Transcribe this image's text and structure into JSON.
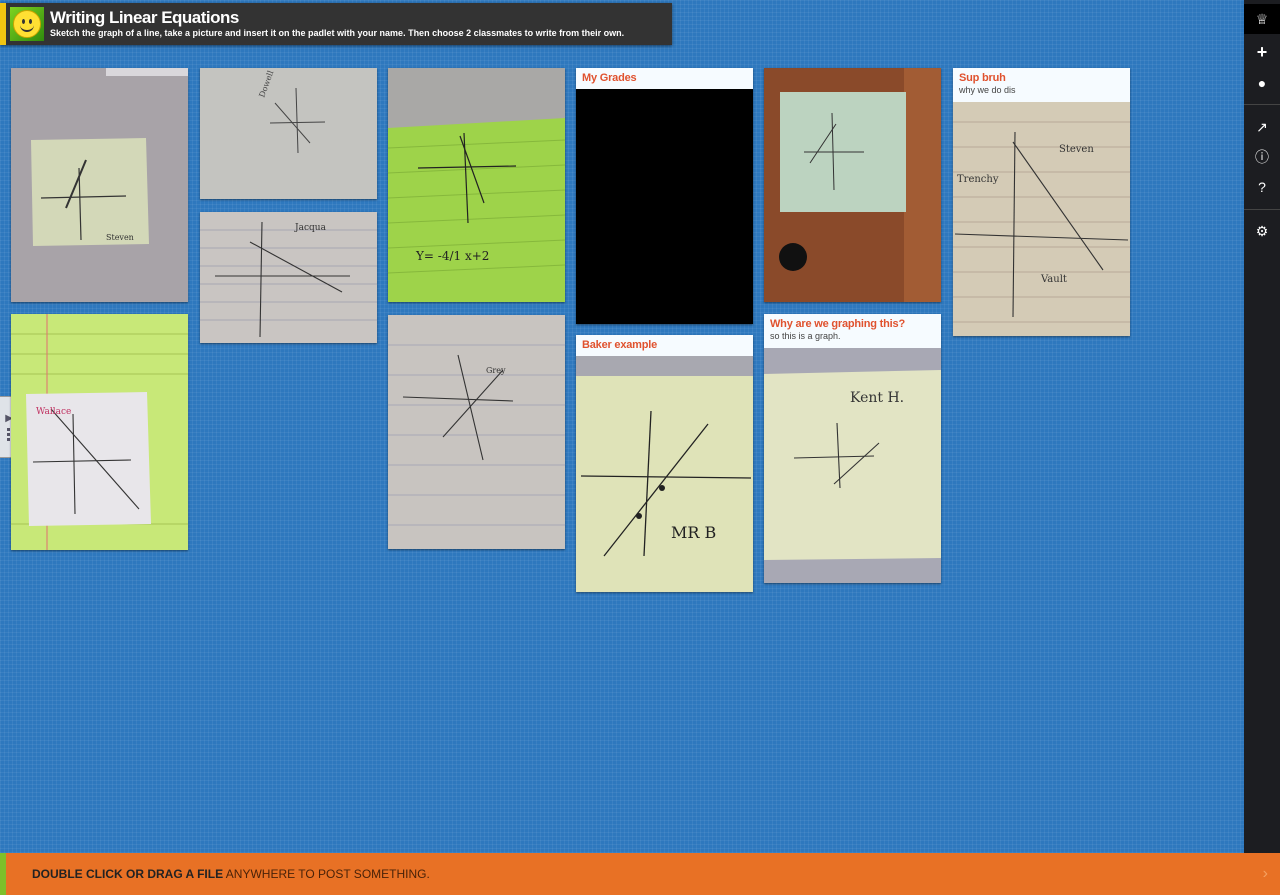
{
  "header": {
    "title": "Writing Linear Equations",
    "description": "Sketch the graph of a line, take a picture and insert it on the padlet with your name. Then choose 2 classmates to write from their own."
  },
  "posts": {
    "my_grades": {
      "title": "My Grades"
    },
    "sup_bruh": {
      "title": "Sup bruh",
      "body": "why we do dis"
    },
    "baker": {
      "title": "Baker example"
    },
    "why_graph": {
      "title": "Why are we graphing this?",
      "body": "so this is a graph."
    }
  },
  "footer": {
    "action": "DOUBLE CLICK OR DRAG A FILE",
    "rest": " ANYWHERE TO POST SOMETHING."
  },
  "toolbar": {
    "icons": [
      "padlet-crown-icon",
      "add-icon",
      "user-icon",
      "share-icon",
      "info-icon",
      "help-icon",
      "settings-icon"
    ]
  },
  "colors": {
    "background": "#2e78be",
    "header": "#333333",
    "footer": "#e87125",
    "card_title": "#e0522f"
  }
}
